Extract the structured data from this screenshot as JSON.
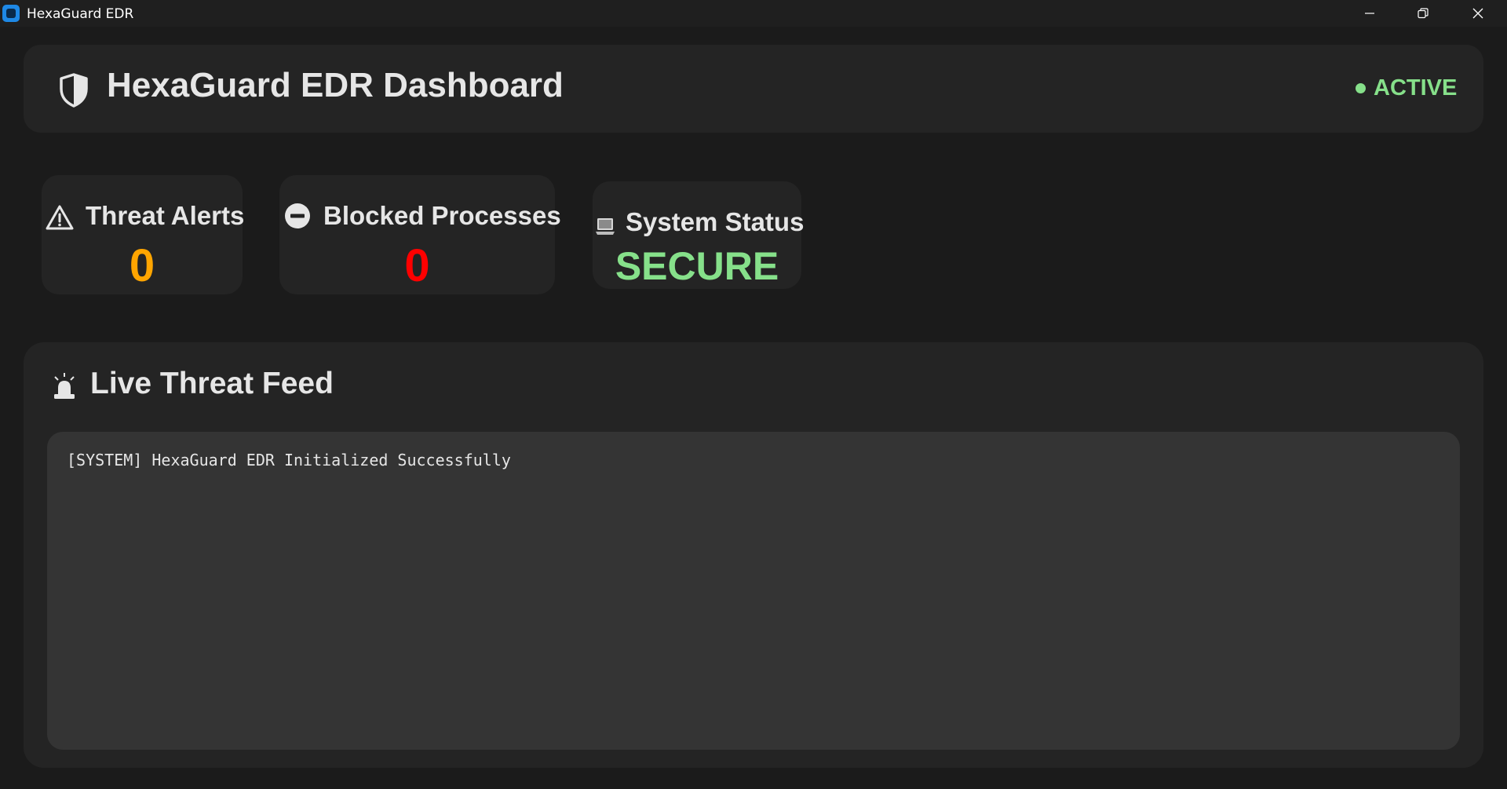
{
  "window": {
    "title": "HexaGuard EDR",
    "controls": [
      "minimize",
      "maximize",
      "close"
    ]
  },
  "header": {
    "title": "HexaGuard EDR Dashboard",
    "icon": "shield-icon",
    "status_label": "ACTIVE",
    "status_color": "#86e08a"
  },
  "stats": {
    "threat_alerts": {
      "label": "Threat Alerts",
      "value": "0",
      "icon": "warning-icon",
      "color": "#ffa500"
    },
    "blocked_processes": {
      "label": "Blocked Processes",
      "value": "0",
      "icon": "no-entry-icon",
      "color": "#ff0000"
    },
    "system_status": {
      "label": "System Status",
      "value": "SECURE",
      "icon": "laptop-icon",
      "color": "#86e08a"
    }
  },
  "feed": {
    "title": "Live Threat Feed",
    "icon": "siren-icon",
    "lines": [
      "[SYSTEM] HexaGuard EDR Initialized Successfully"
    ]
  },
  "colors": {
    "background": "#1b1b1b",
    "card": "#242424",
    "feed_box": "#343434",
    "text": "#e6e6e6"
  }
}
